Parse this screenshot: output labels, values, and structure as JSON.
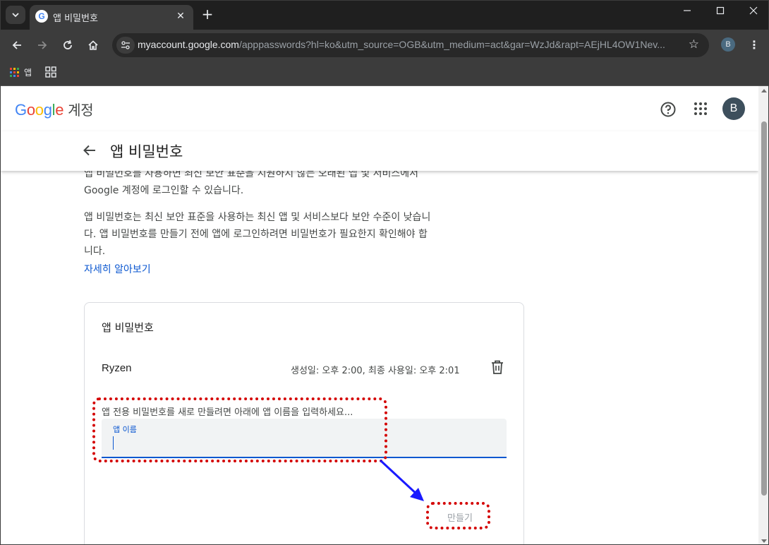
{
  "browser": {
    "tab_title": "앱 비밀번호",
    "favicon_letter": "G",
    "close_glyph": "✕",
    "new_tab_glyph": "+",
    "url_host": "myaccount.google.com",
    "url_path": "/apppasswords?hl=ko&utm_source=OGB&utm_medium=act&gar=WzJd&rapt=AEjHL4OW1Nev...",
    "profile_initial": "B",
    "window_controls": [
      "minimize-icon",
      "maximize-icon",
      "close-icon"
    ],
    "bookmarks": {
      "apps_label": "앱"
    }
  },
  "header": {
    "logo_letters": [
      {
        "char": "G",
        "color": "#4285f4"
      },
      {
        "char": "o",
        "color": "#ea4335"
      },
      {
        "char": "o",
        "color": "#fbbc05"
      },
      {
        "char": "g",
        "color": "#4285f4"
      },
      {
        "char": "l",
        "color": "#34a853"
      },
      {
        "char": "e",
        "color": "#ea4335"
      }
    ],
    "account_label": "계정",
    "avatar_initial": "B"
  },
  "page": {
    "title": "앱 비밀번호",
    "desc_line1": "앱 비밀번호를 사용하면 최신 보안 표준을 지원하지 않는 오래된 앱 및 서비스에서",
    "desc_line2": "Google 계정에 로그인할 수 있습니다.",
    "desc2_line1": "앱 비밀번호는 최신 보안 표준을 사용하는 최신 앱 및 서비스보다 보안 수준이 낮습니",
    "desc2_line2": "다. 앱 비밀번호를 만들기 전에 앱에 로그인하려면 비밀번호가 필요한지 확인해야 합",
    "desc2_line3": "니다.",
    "learn_more": "자세히 알아보기"
  },
  "card": {
    "title": "앱 비밀번호",
    "passwords": [
      {
        "name": "Ryzen",
        "meta": "생성일: 오후 2:00, 최종 사용일: 오후 2:01"
      }
    ],
    "prompt": "앱 전용 비밀번호를 새로 만들려면 아래에 앱 이름을 입력하세요...",
    "field_label": "앱 이름",
    "field_value": "",
    "create_label": "만들기"
  },
  "colors": {
    "accent": "#0b57d0",
    "annotation_red": "#d40000",
    "annotation_arrow": "#1a1aff"
  }
}
